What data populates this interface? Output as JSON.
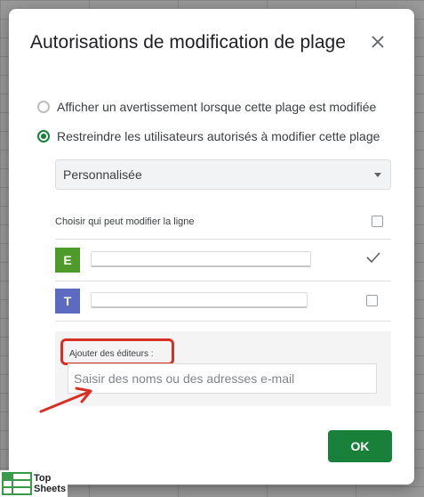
{
  "dialog": {
    "title": "Autorisations de modification de plage",
    "options": [
      {
        "label": "Afficher un avertissement lorsque cette plage est modifiée",
        "checked": false
      },
      {
        "label": "Restreindre les utilisateurs autorisés à modifier cette plage",
        "checked": true
      }
    ],
    "select_value": "Personnalisée",
    "section_label": "Choisir qui peut modifier la ligne",
    "users": [
      {
        "initial": "E",
        "color": "#4e9a2a",
        "checked": true
      },
      {
        "initial": "T",
        "color": "#5c6bc0",
        "checked": false
      }
    ],
    "editors": {
      "label": "Ajouter des éditeurs :",
      "placeholder": "Saisir des noms ou des adresses e-mail"
    },
    "ok_label": "OK"
  },
  "colors": {
    "accent": "#188038",
    "highlight": "#d93025"
  },
  "icons": {
    "close": "close-icon",
    "dropdown": "chevron-down-icon",
    "check": "checkmark-icon"
  },
  "watermark": {
    "line1": "Top",
    "line2": "Sheets"
  }
}
